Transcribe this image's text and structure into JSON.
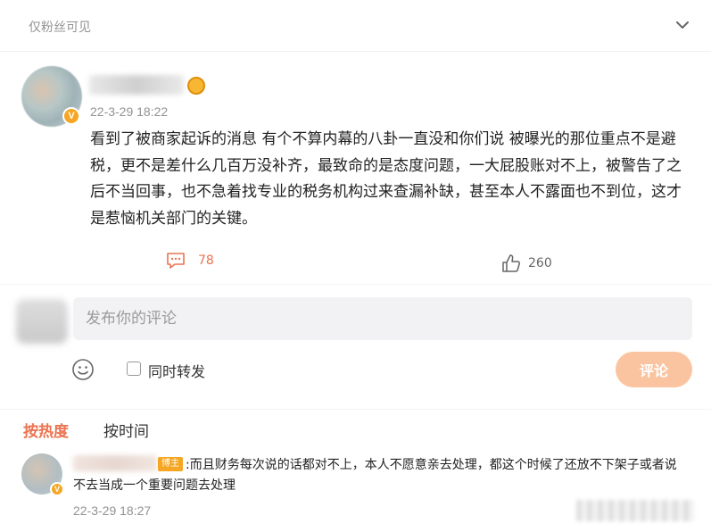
{
  "header": {
    "visibility": "仅粉丝可见"
  },
  "post": {
    "time": "22-3-29 18:22",
    "text": "看到了被商家起诉的消息 有个不算内幕的八卦一直没和你们说  被曝光的那位重点不是避税，更不是差什么几百万没补齐，最致命的是态度问题，一大屁股账对不上，被警告了之后不当回事，也不急着找专业的税务机构过来查漏补缺，甚至本人不露面也不到位，这才是惹恼机关部门的关键。",
    "reply_count": "78",
    "like_count": "260"
  },
  "composer": {
    "placeholder": "发布你的评论",
    "repost_label": "同时转发",
    "submit_label": "评论"
  },
  "sort": {
    "hot_label": "按热度",
    "time_label": "按时间"
  },
  "reply": {
    "author_tag": "博主",
    "text": ":而且财务每次说的话都对不上，本人不愿意亲去处理，都这个时候了还放不下架子或者说不去当成一个重要问题去处理",
    "time": "22-3-29 18:27"
  },
  "colors": {
    "accent": "#eb7350",
    "verified": "#f5a623",
    "submit_disabled": "#fbc4a0",
    "muted_text": "#939393",
    "input_bg": "#f2f2f5"
  },
  "icons": {
    "collapse": "chevron-down-icon",
    "verified": "verified-v-icon",
    "reply": "comment-bubble-icon",
    "like": "thumbs-up-icon",
    "emoji": "smiley-icon"
  }
}
